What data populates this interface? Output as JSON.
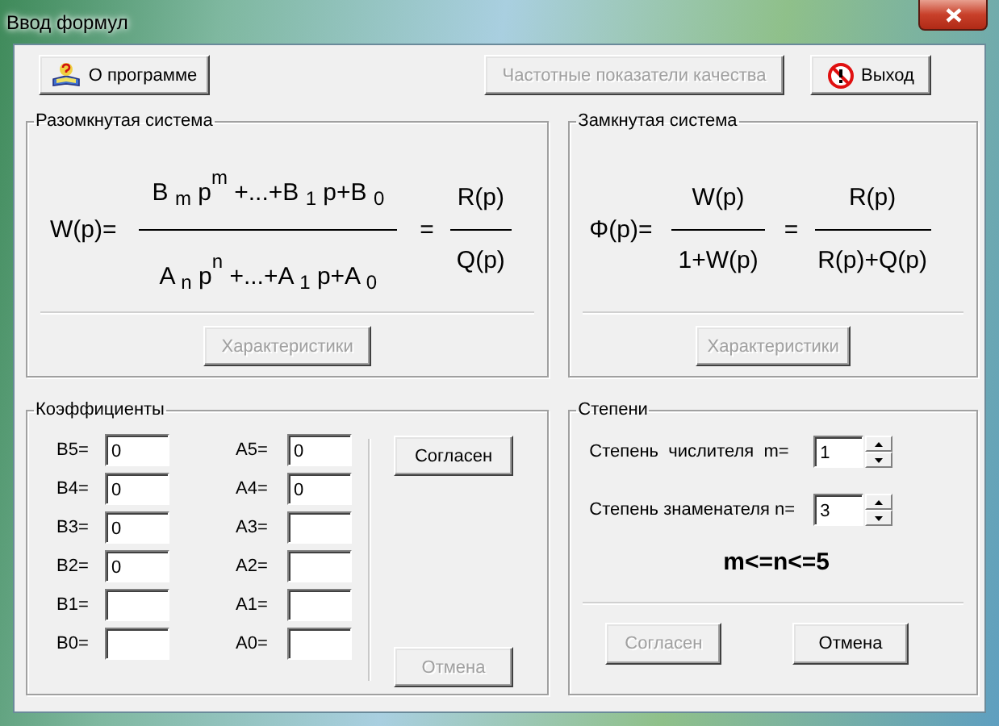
{
  "window": {
    "title": "Ввод формул"
  },
  "toolbar": [
    {
      "label": "О программе",
      "disabled": false,
      "kind": "help"
    },
    {
      "label": "Частотные показатели качества",
      "disabled": true,
      "kind": "plain"
    },
    {
      "label": "Выход",
      "disabled": false,
      "kind": "exit"
    }
  ],
  "open_loop": {
    "title": "Разомкнутая система",
    "lhs": "W(p)=",
    "numerator": "B $_{m}$ p$^{m}$ +...+B $_{1}$ p+B $_{0}$",
    "denominator": "A $_{n}$ p$^{n}$ +...+A $_{1}$ p+A $_{0}$",
    "equals": "=",
    "result_numerator": "R(p)",
    "result_denominator": "Q(p)",
    "button": {
      "label": "Характеристики",
      "disabled": true
    }
  },
  "closed_loop": {
    "title": "Замкнутая система",
    "lhs": "Φ(p)=",
    "numerator": "W(p)",
    "denominator": "1+W(p)",
    "equals": "=",
    "result_numerator": "R(p)",
    "result_denominator": "R(p)+Q(p)",
    "button": {
      "label": "Характеристики",
      "disabled": true
    }
  },
  "coefficients": {
    "title": "Коэффициенты",
    "b": [
      {
        "label": "B5=",
        "value": "0"
      },
      {
        "label": "B4=",
        "value": "0"
      },
      {
        "label": "B3=",
        "value": "0"
      },
      {
        "label": "B2=",
        "value": "0"
      },
      {
        "label": "B1="
      },
      {
        "label": "B0="
      }
    ],
    "a": [
      {
        "label": "A5=",
        "value": "0"
      },
      {
        "label": "A4=",
        "value": "0"
      },
      {
        "label": "A3="
      },
      {
        "label": "A2="
      },
      {
        "label": "A1="
      },
      {
        "label": "A0="
      }
    ],
    "buttons": [
      {
        "label": "Согласен",
        "disabled": false
      },
      {
        "label": "Отмена",
        "disabled": true
      }
    ]
  },
  "degrees": {
    "title": "Степени",
    "fields": [
      {
        "label": "Степень  числителя  m=",
        "value": "1"
      },
      {
        "label": "Степень знаменателя n=",
        "value": "3"
      }
    ],
    "constraint": "m<=n<=5",
    "buttons": [
      {
        "label": "Согласен",
        "disabled": true
      },
      {
        "label": "Отмена",
        "disabled": false
      }
    ]
  }
}
